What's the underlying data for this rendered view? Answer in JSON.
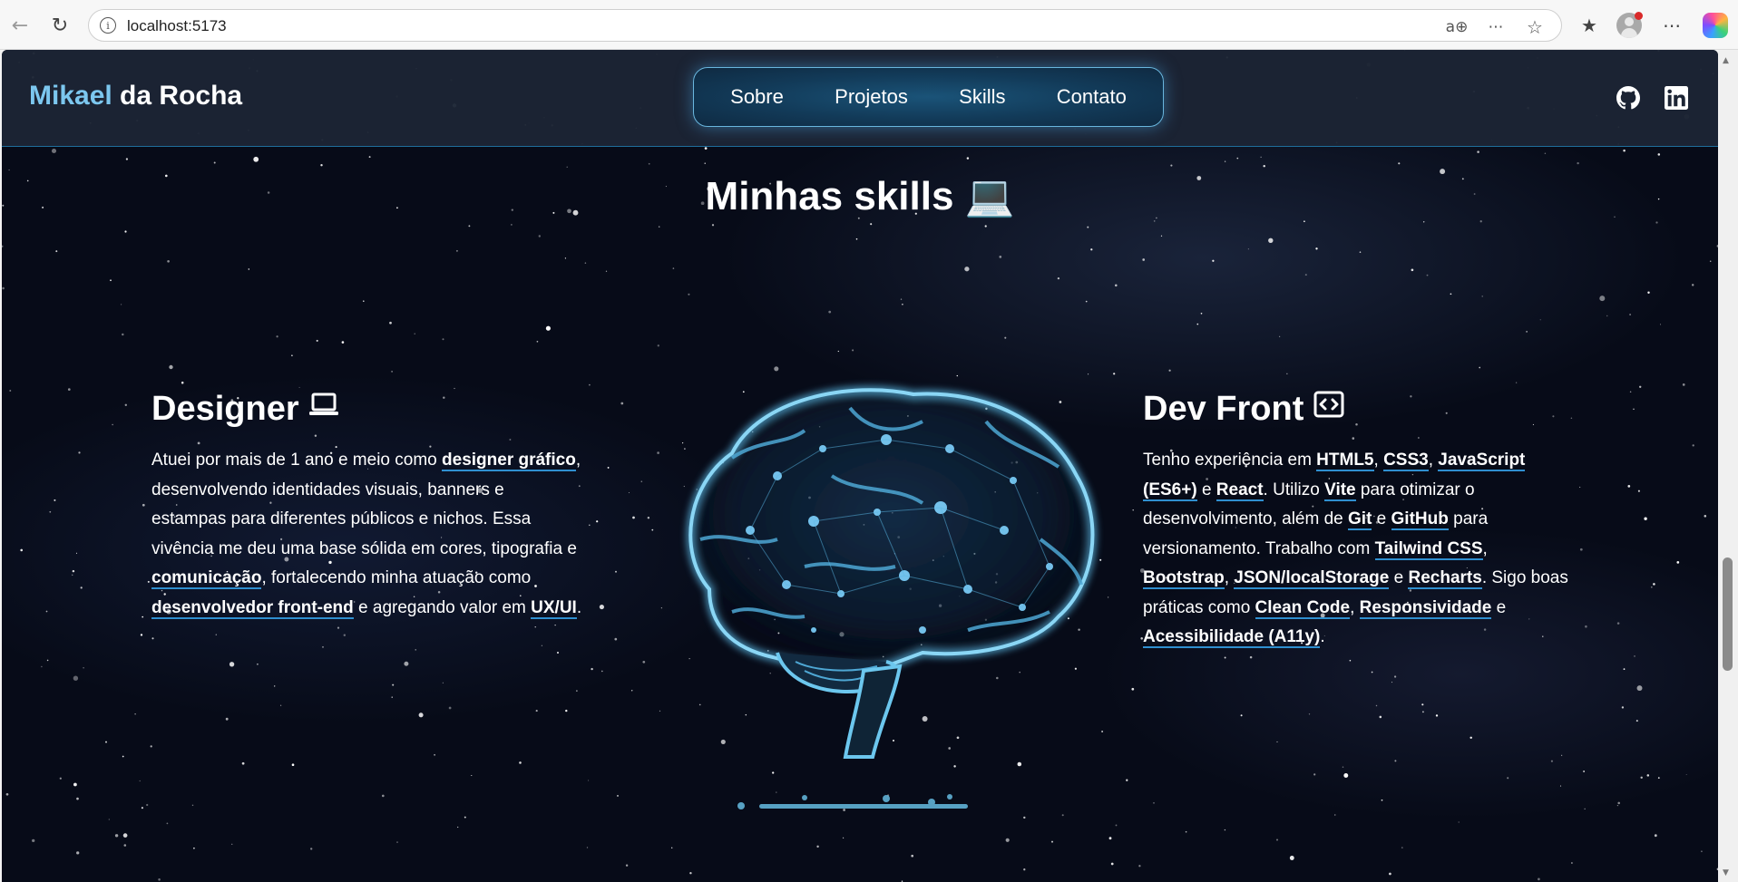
{
  "browser": {
    "url": "localhost:5173"
  },
  "site": {
    "logo_first": "Mikael",
    "logo_rest": " da Rocha",
    "nav": [
      "Sobre",
      "Projetos",
      "Skills",
      "Contato"
    ],
    "social": [
      "github-icon",
      "linkedin-icon"
    ]
  },
  "skills": {
    "title": "Minhas skills 💻",
    "designer": {
      "title": "Designer",
      "icon": "laptop-icon",
      "text": [
        {
          "t": "Atuei por mais de 1 ano e meio como "
        },
        {
          "t": "designer gráfico",
          "b": true
        },
        {
          "t": ", desenvolvendo identidades visuais, banners e estampas para diferentes públicos e nichos. Essa vivência me deu uma base sólida em cores, tipografia e "
        },
        {
          "t": "comunicação",
          "b": true
        },
        {
          "t": ", fortalecendo minha atuação como "
        },
        {
          "t": "desenvolvedor front-end",
          "b": true
        },
        {
          "t": " e agregando valor em "
        },
        {
          "t": "UX/UI",
          "b": true
        },
        {
          "t": "."
        }
      ]
    },
    "dev": {
      "title": "Dev Front",
      "icon": "code-icon",
      "text": [
        {
          "t": "Tenho experiência em "
        },
        {
          "t": "HTML5",
          "b": true
        },
        {
          "t": ", "
        },
        {
          "t": "CSS3",
          "b": true
        },
        {
          "t": ", "
        },
        {
          "t": "JavaScript (ES6+)",
          "b": true
        },
        {
          "t": " e "
        },
        {
          "t": "React",
          "b": true
        },
        {
          "t": ". Utilizo "
        },
        {
          "t": "Vite",
          "b": true
        },
        {
          "t": " para otimizar o desenvolvimento, além de "
        },
        {
          "t": "Git",
          "b": true
        },
        {
          "t": " e "
        },
        {
          "t": "GitHub",
          "b": true
        },
        {
          "t": " para versionamento. Trabalho com "
        },
        {
          "t": "Tailwind CSS",
          "b": true
        },
        {
          "t": ", "
        },
        {
          "t": "Bootstrap",
          "b": true
        },
        {
          "t": ", "
        },
        {
          "t": "JSON/localStorage",
          "b": true
        },
        {
          "t": " e "
        },
        {
          "t": "Recharts",
          "b": true
        },
        {
          "t": ". Sigo boas práticas como "
        },
        {
          "t": "Clean Code",
          "b": true
        },
        {
          "t": ", "
        },
        {
          "t": "Responsividade",
          "b": true
        },
        {
          "t": " e "
        },
        {
          "t": "Acessibilidade (A11y)",
          "b": true
        },
        {
          "t": "."
        }
      ]
    }
  },
  "colors": {
    "accent": "#7cc7ef",
    "underline": "#2f8fd0",
    "header_bg": "#1c2434",
    "background": "#070b18"
  }
}
